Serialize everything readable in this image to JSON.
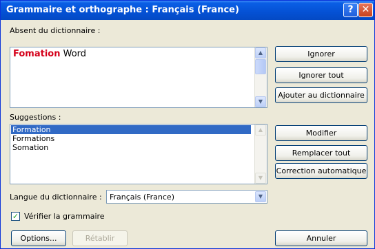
{
  "window": {
    "title": "Grammaire et orthographe : Français (France)"
  },
  "titlebar": {
    "help_glyph": "?",
    "close_glyph": "✕"
  },
  "absent": {
    "label": "Absent du dictionnaire :",
    "error_word": "Fomation",
    "rest": " Word"
  },
  "suggestions": {
    "label": "Suggestions :",
    "items": [
      "Formation",
      "Formations",
      "Somation"
    ],
    "selected_index": 0
  },
  "language": {
    "label": "Langue du dictionnaire :",
    "value": "Français (France)"
  },
  "grammar_check": {
    "label": "Vérifier la grammaire",
    "checked": true
  },
  "buttons": {
    "ignore": "Ignorer",
    "ignore_all": "Ignorer tout",
    "add_dict": "Ajouter au dictionnaire",
    "modify": "Modifier",
    "replace_all": "Remplacer tout",
    "autocorrect": "Correction automatique",
    "options": "Options...",
    "restore": "Rétablir",
    "cancel": "Annuler"
  },
  "icons": {
    "up": "▲",
    "down": "▼",
    "check": "✓"
  },
  "colors": {
    "titlebar": "#0552d6",
    "error_word": "#d4001a",
    "selection": "#316ac5",
    "dialog_bg": "#ece9d8"
  }
}
